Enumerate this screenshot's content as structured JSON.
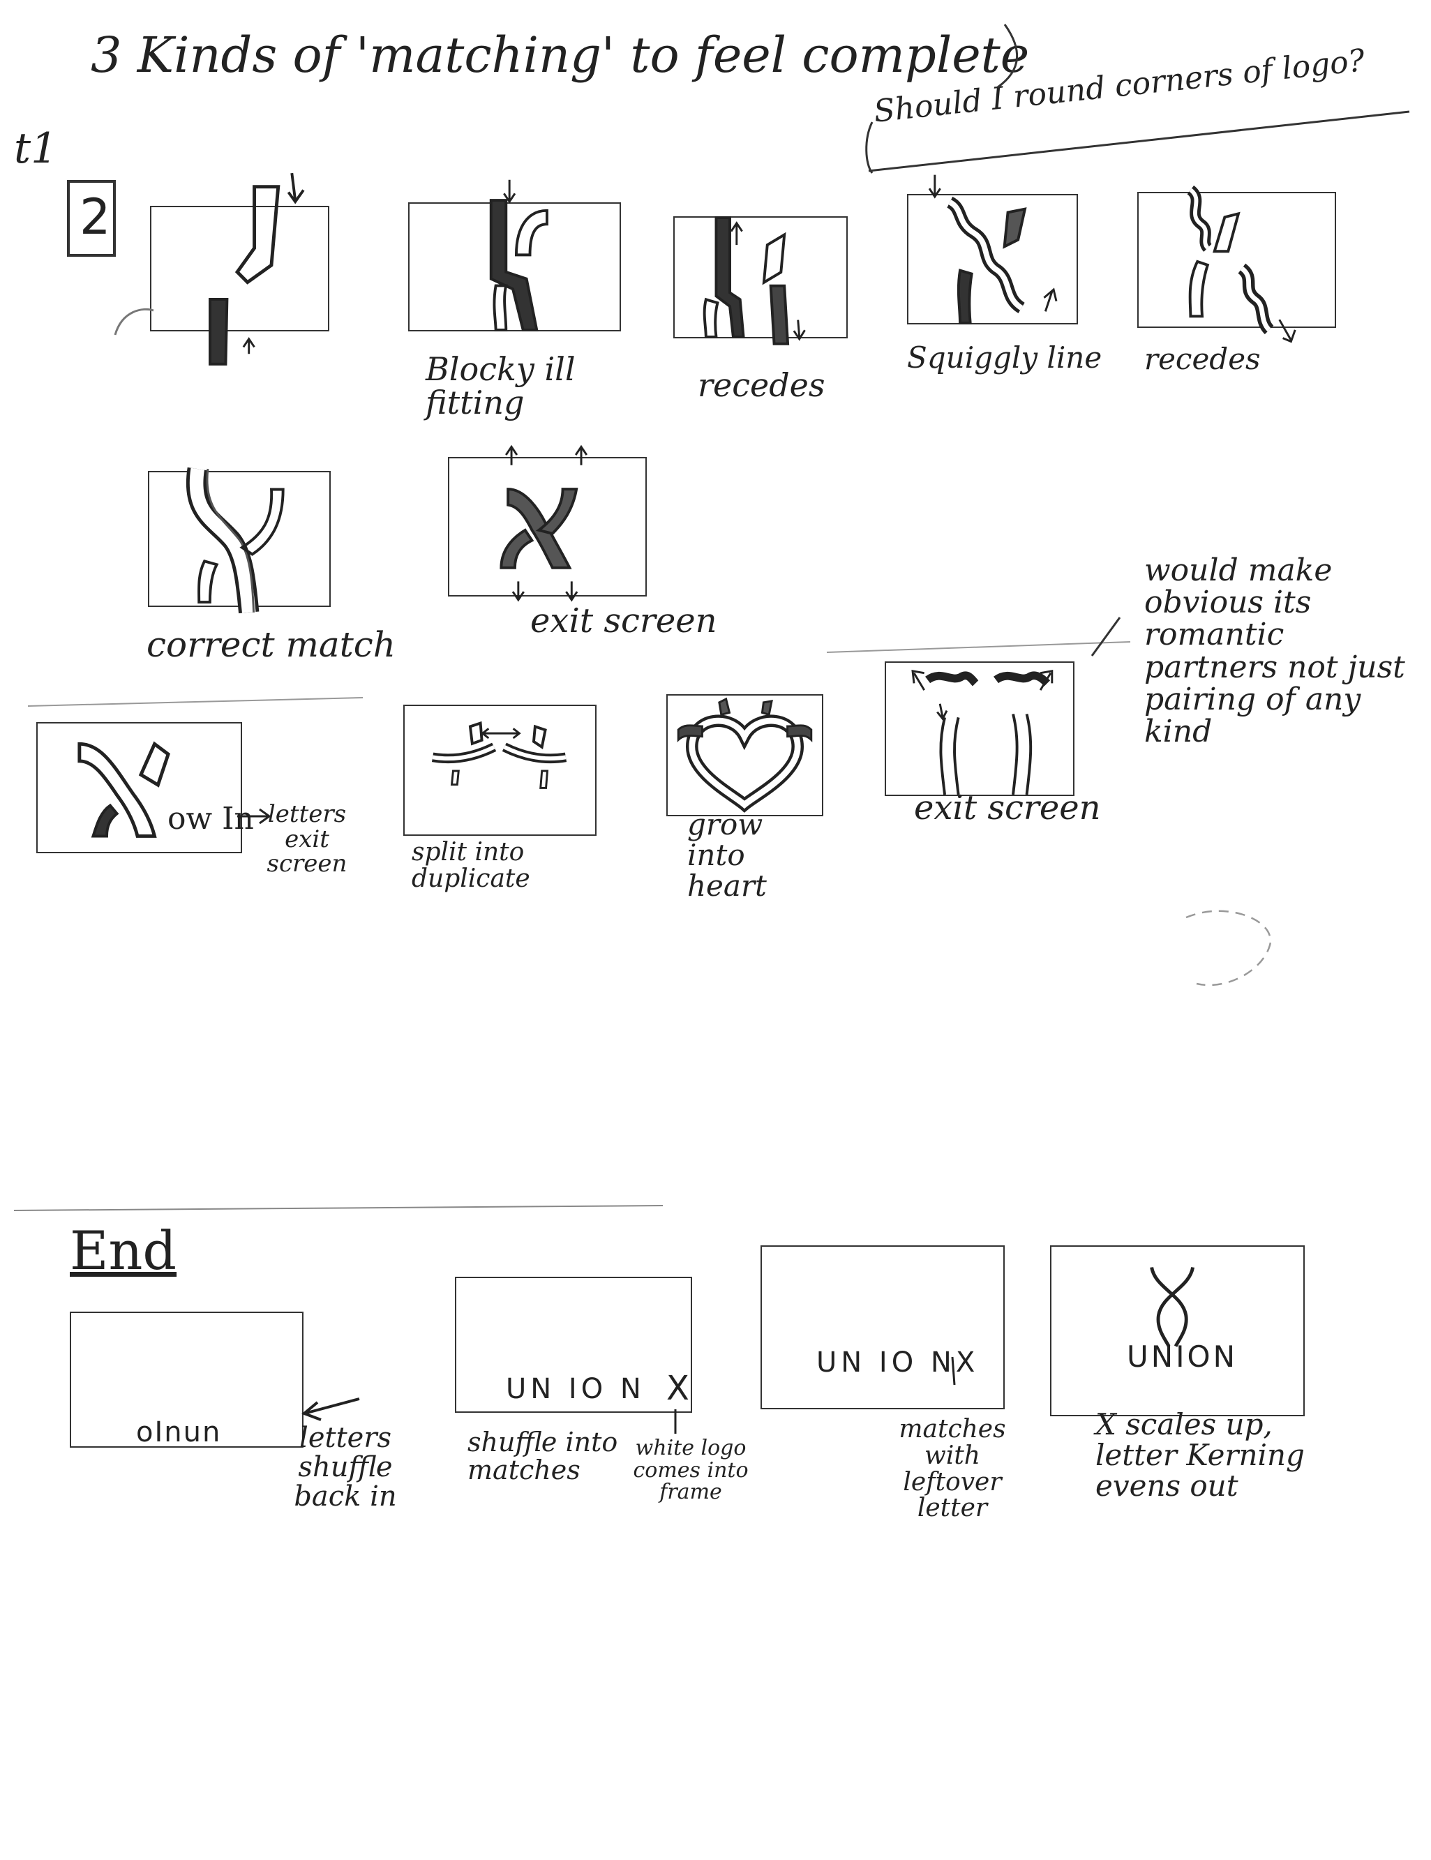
{
  "header": {
    "title": "3 Kinds of 'matching' to feel complete",
    "note": "Should I round corners of logo?",
    "section_mark": "t1",
    "box_number": "2"
  },
  "row1": {
    "captions": [
      "Blocky ill fitting",
      "recedes",
      "Squiggly line",
      "recedes"
    ]
  },
  "row2": {
    "captions": [
      "correct match",
      "exit screen"
    ]
  },
  "row3": {
    "logo_text": "ow In",
    "note_letters": "letters exit screen",
    "captions": [
      "split into duplicate",
      "grow into heart",
      "exit screen"
    ],
    "side_note": "would make obvious its romantic partners not just pairing of any kind"
  },
  "end": {
    "heading": "End",
    "panel_texts": [
      "oInun",
      "UN IO N",
      "UN IO NX",
      "UNION"
    ],
    "extra_x": "X",
    "captions": [
      "letters shuffle back in",
      "shuffle into matches",
      "white logo comes into frame",
      "matches with leftover letter",
      "X scales up, letter Kerning evens out"
    ]
  }
}
